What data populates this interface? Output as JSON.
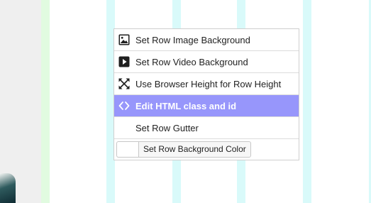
{
  "menu": {
    "items": [
      {
        "label": "Set Row Image Background",
        "icon": "image-icon"
      },
      {
        "label": "Set Row Video Background",
        "icon": "video-play-icon"
      },
      {
        "label": "Use Browser Height for Row Height",
        "icon": "expand-arrows-icon"
      },
      {
        "label": "Edit HTML class and id",
        "icon": "code-brackets-icon",
        "active": true
      },
      {
        "label": "Set Row Gutter",
        "icon": ""
      }
    ],
    "color_button_label": "Set Row Background Color"
  },
  "colors": {
    "active_item_bg": "#9796fb",
    "guide": "#d9fafa",
    "row_border": "#e1fbe0"
  }
}
